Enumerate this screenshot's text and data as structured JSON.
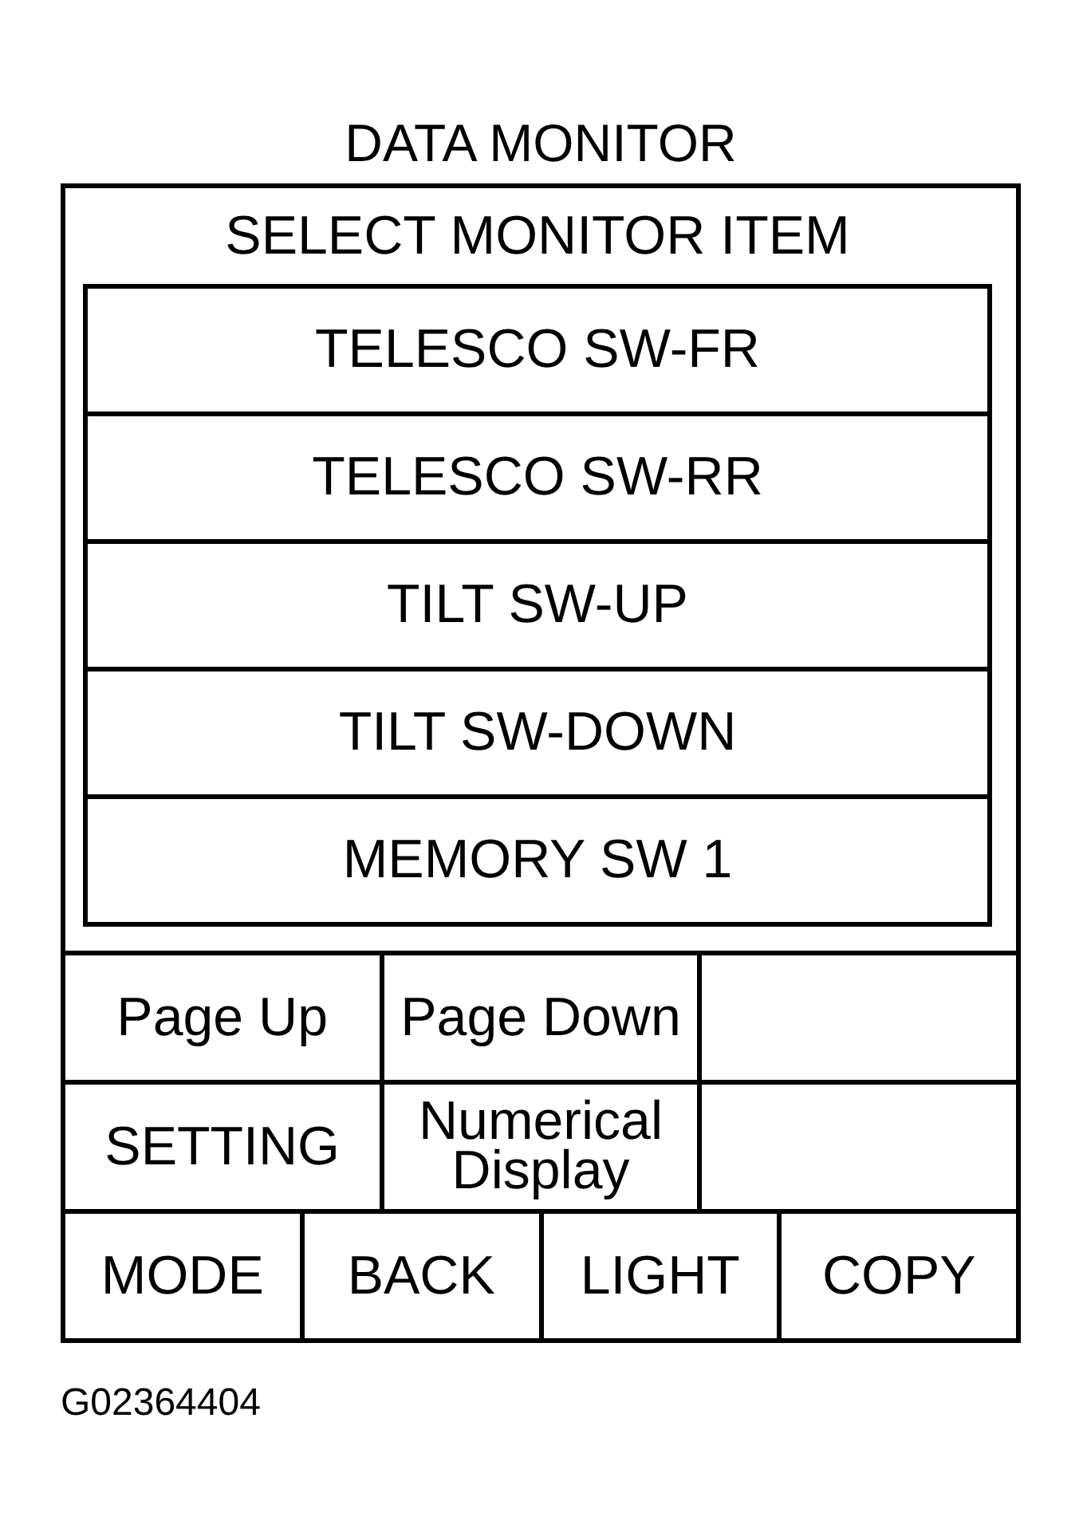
{
  "title": "DATA MONITOR",
  "panel": {
    "heading": "SELECT MONITOR ITEM",
    "items": [
      "TELESCO SW-FR",
      "TELESCO SW-RR",
      "TILT SW-UP",
      "TILT SW-DOWN",
      "MEMORY SW 1"
    ]
  },
  "key_rows": [
    [
      {
        "kind": "key",
        "label": "Page Up"
      },
      {
        "kind": "key",
        "label": "Page Down"
      },
      {
        "kind": "blank"
      }
    ],
    [
      {
        "kind": "key",
        "label": "SETTING"
      },
      {
        "kind": "key",
        "label": "Numerical Display"
      },
      {
        "kind": "blank"
      }
    ],
    [
      {
        "kind": "key",
        "label": "MODE"
      },
      {
        "kind": "key",
        "label": "BACK"
      },
      {
        "kind": "key",
        "label": "LIGHT"
      },
      {
        "kind": "key",
        "label": "COPY"
      }
    ]
  ],
  "figure_code": "G02364404"
}
